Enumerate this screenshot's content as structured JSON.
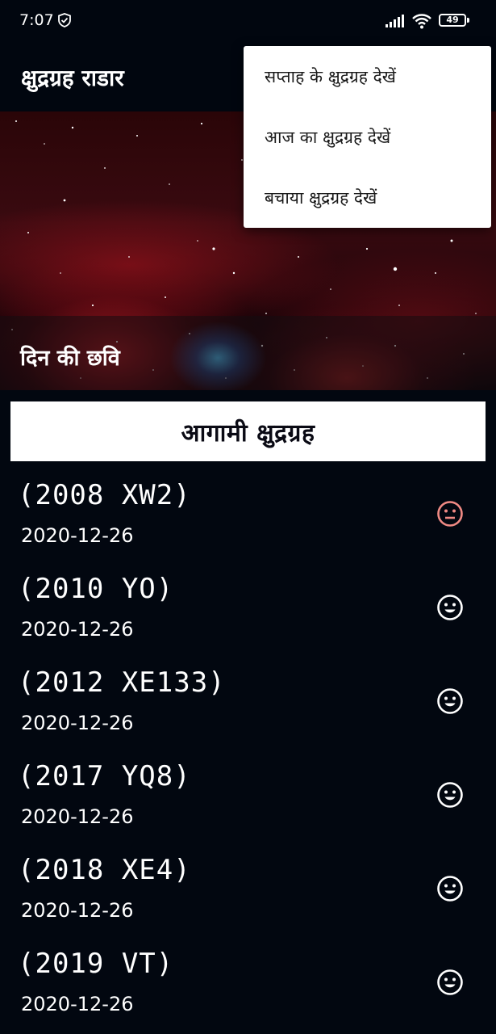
{
  "status_bar": {
    "time": "7:07",
    "battery": "49"
  },
  "toolbar": {
    "title": "क्षुद्रग्रह राडार"
  },
  "hero": {
    "caption": "दिन की छवि"
  },
  "section": {
    "title": "आगामी  क्षुद्रग्रह"
  },
  "asteroids": [
    {
      "name": "(2008 XW2)",
      "date": "2020-12-26",
      "icon": "neutral-face-icon",
      "icon_color": "#f08a84"
    },
    {
      "name": "(2010 YO)",
      "date": "2020-12-26",
      "icon": "smiley-face-icon",
      "icon_color": "#ffffff"
    },
    {
      "name": "(2012 XE133)",
      "date": "2020-12-26",
      "icon": "smiley-face-icon",
      "icon_color": "#ffffff"
    },
    {
      "name": "(2017 YQ8)",
      "date": "2020-12-26",
      "icon": "smiley-face-icon",
      "icon_color": "#ffffff"
    },
    {
      "name": "(2018 XE4)",
      "date": "2020-12-26",
      "icon": "smiley-face-icon",
      "icon_color": "#ffffff"
    },
    {
      "name": "(2019 VT)",
      "date": "2020-12-26",
      "icon": "smiley-face-icon",
      "icon_color": "#ffffff"
    }
  ],
  "menu": {
    "items": [
      {
        "label": "सप्ताह के क्षुद्रग्रह देखें"
      },
      {
        "label": "आज का क्षुद्रग्रह देखें"
      },
      {
        "label": "बचाया क्षुद्रग्रह देखें"
      }
    ]
  },
  "colors": {
    "background": "#020710",
    "hazard": "#f08a84",
    "safe": "#ffffff"
  }
}
